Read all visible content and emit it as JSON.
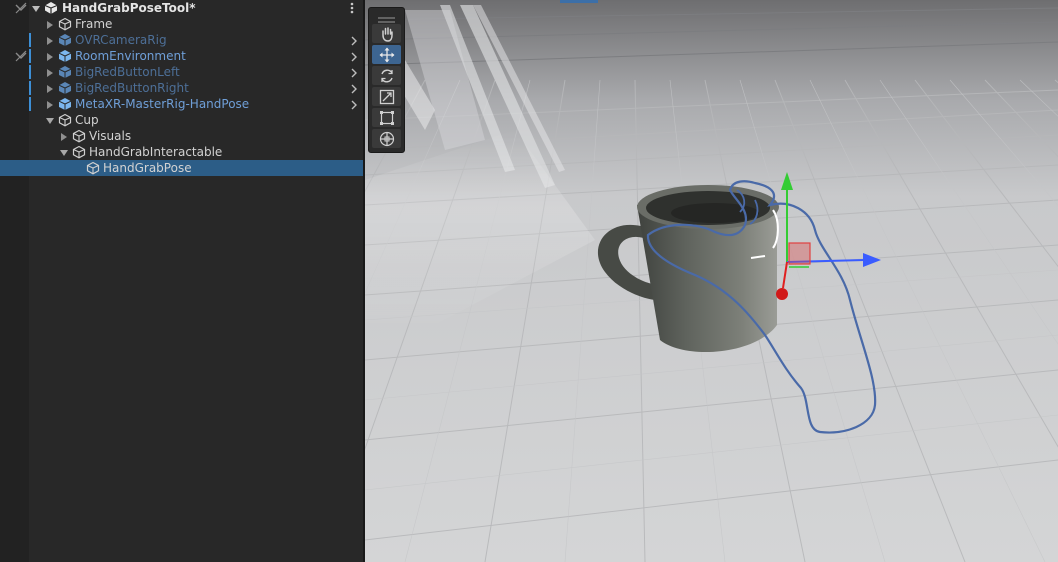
{
  "hierarchy": {
    "scene_name": "HandGrabPoseTool*",
    "rows": [
      {
        "label": "Frame",
        "style": "normal",
        "depth": 1,
        "has_children": true,
        "expanded": false
      },
      {
        "label": "OVRCameraRig",
        "style": "prefab-dim",
        "depth": 1,
        "has_children": true,
        "expanded": false
      },
      {
        "label": "RoomEnvironment",
        "style": "prefab",
        "depth": 1,
        "has_children": true,
        "expanded": false
      },
      {
        "label": "BigRedButtonLeft",
        "style": "prefab-dim",
        "depth": 1,
        "has_children": true,
        "expanded": false
      },
      {
        "label": "BigRedButtonRight",
        "style": "prefab-dim",
        "depth": 1,
        "has_children": true,
        "expanded": false
      },
      {
        "label": "MetaXR-MasterRig-HandPose",
        "style": "prefab",
        "depth": 1,
        "has_children": true,
        "expanded": false
      },
      {
        "label": "Cup",
        "style": "normal",
        "depth": 1,
        "has_children": true,
        "expanded": true
      },
      {
        "label": "Visuals",
        "style": "normal",
        "depth": 2,
        "has_children": true,
        "expanded": false
      },
      {
        "label": "HandGrabInteractable",
        "style": "normal",
        "depth": 2,
        "has_children": true,
        "expanded": true
      },
      {
        "label": "HandGrabPose",
        "style": "normal",
        "depth": 3,
        "has_children": false,
        "expanded": false,
        "selected": true
      }
    ]
  },
  "scene_view": {
    "tools": [
      "view-tool",
      "move-tool",
      "rotate-tool",
      "scale-tool",
      "rect-tool",
      "transform-tool"
    ],
    "active_tool": "move-tool"
  },
  "colors": {
    "selection": "#2c5d87",
    "prefab_text": "#6f9fd8",
    "gizmo_x": "#3a5cff",
    "gizmo_y": "#33cc33",
    "gizmo_z": "#e01f1f",
    "hand_outline": "#4a6aa8"
  }
}
